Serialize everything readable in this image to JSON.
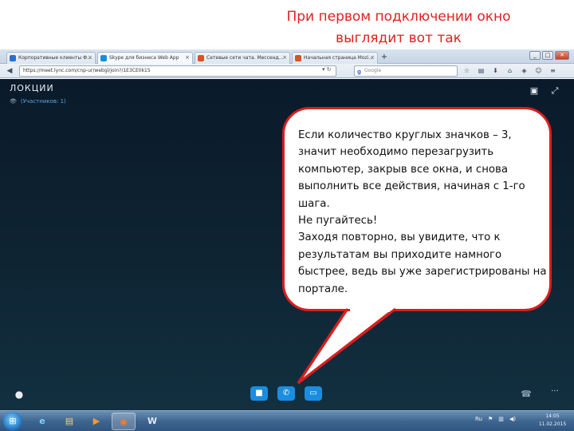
{
  "slide": {
    "title_line1": "При первом подключении окно",
    "title_line2": "выглядит вот так"
  },
  "browser": {
    "tabs": [
      {
        "label": "Корпоративные клиенты Ф...",
        "color": "#2b6fd1"
      },
      {
        "label": "Skype для бизнеса Web App",
        "color": "#1a8ddf"
      },
      {
        "label": "Сетевые сети чата. Мессенд...",
        "color": "#d9531e"
      },
      {
        "label": "Начальная страница Mozi...",
        "color": "#d9531e"
      }
    ],
    "new_tab_label": "+",
    "url": "https://meet.lync.com/cnp-ur/webgl/join?/1E3CE0k15",
    "search_placeholder": "Google",
    "window_buttons": {
      "minimize": "_",
      "maximize": "□",
      "close": "✕"
    }
  },
  "app": {
    "title": "ЛОКЦИИ",
    "participants": "(Участников: 1)",
    "icons": {
      "share": "▣",
      "fullscreen": "⤢",
      "chat": "💬",
      "video": "■",
      "phone": "✆",
      "screen": "▭",
      "devices": "☎",
      "more": "···"
    }
  },
  "taskbar": {
    "start": "⊞",
    "tray_lang": "Ru",
    "clock_time": "14:05",
    "clock_date": "11.02.2015",
    "apps": [
      {
        "name": "ie",
        "glyph": "e"
      },
      {
        "name": "explorer",
        "glyph": "▤"
      },
      {
        "name": "media",
        "glyph": "▶"
      },
      {
        "name": "firefox",
        "glyph": "◉"
      },
      {
        "name": "word",
        "glyph": "W"
      }
    ]
  },
  "callout": {
    "paragraph1": "Если количество круглых значков – 3, значит необходимо перезагрузить компьютер, закрыв все окна, и снова выполнить все действия, начиная с 1-го шага.",
    "paragraph2": "Не пугайтесь!",
    "paragraph3": "Заходя повторно, вы увидите, что к результатам вы приходите намного быстрее, ведь вы уже зарегистрированы на портале.",
    "border_color": "#d91e1e"
  }
}
